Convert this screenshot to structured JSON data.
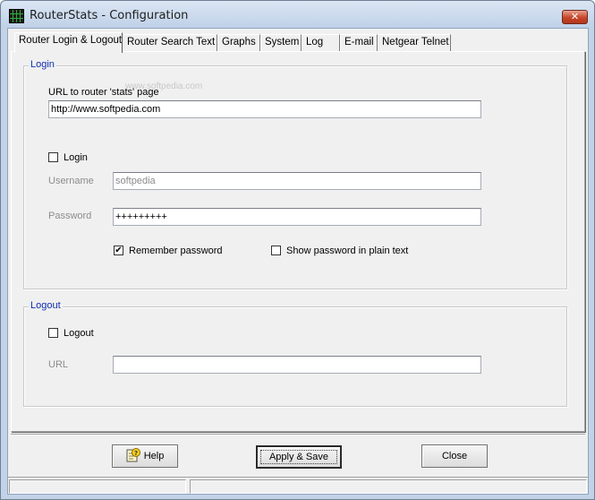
{
  "window": {
    "title": "RouterStats - Configuration",
    "close_glyph": "✕"
  },
  "tabs": [
    {
      "label": "Router Login & Logout",
      "active": true
    },
    {
      "label": "Router Search Text"
    },
    {
      "label": "Graphs"
    },
    {
      "label": "System"
    },
    {
      "label": "Log"
    },
    {
      "label": "E-mail"
    },
    {
      "label": "Netgear Telnet"
    }
  ],
  "watermark": "www.softpedia.com",
  "login": {
    "legend": "Login",
    "url_label": "URL to router 'stats' page",
    "url_value": "http://www.softpedia.com",
    "login_checkbox_label": "Login",
    "login_checked": false,
    "username_label": "Username",
    "username_value": "softpedia",
    "password_label": "Password",
    "password_value": "+++++++++",
    "remember_label": "Remember password",
    "remember_checked": true,
    "remember_check_glyph": "✔",
    "show_plain_label": "Show password in plain text",
    "show_plain_checked": false
  },
  "logout": {
    "legend": "Logout",
    "logout_checkbox_label": "Logout",
    "logout_checked": false,
    "url_label": "URL",
    "url_value": ""
  },
  "buttons": {
    "help": "Help",
    "apply_save": "Apply & Save",
    "close": "Close"
  },
  "colors": {
    "legend_text": "#1030b0",
    "disabled_text": "#8c8c8c",
    "close_button": "#c6452a"
  }
}
